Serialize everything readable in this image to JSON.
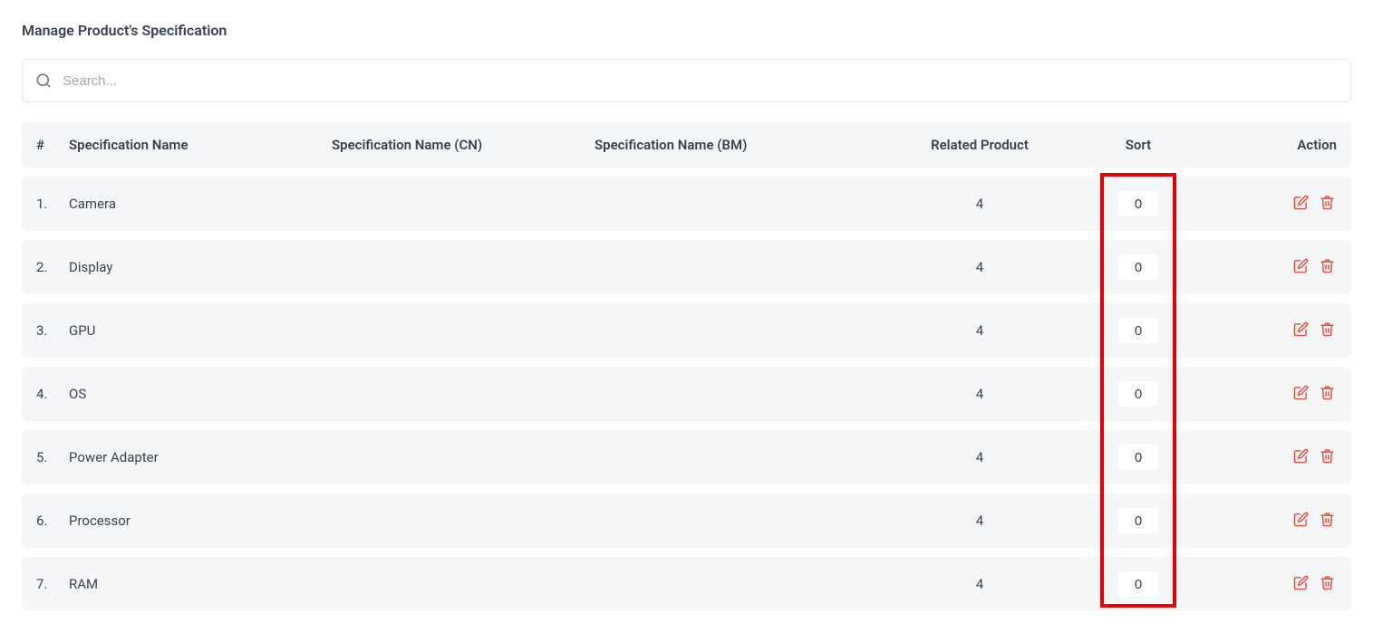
{
  "page": {
    "title": "Manage Product's Specification"
  },
  "search": {
    "placeholder": "Search..."
  },
  "headers": {
    "num": "#",
    "name": "Specification Name",
    "name_cn": "Specification Name (CN)",
    "name_bm": "Specification Name (BM)",
    "related": "Related Product",
    "sort": "Sort",
    "action": "Action"
  },
  "rows": [
    {
      "num": "1.",
      "name": "Camera",
      "name_cn": "",
      "name_bm": "",
      "related": "4",
      "sort": "0"
    },
    {
      "num": "2.",
      "name": "Display",
      "name_cn": "",
      "name_bm": "",
      "related": "4",
      "sort": "0"
    },
    {
      "num": "3.",
      "name": "GPU",
      "name_cn": "",
      "name_bm": "",
      "related": "4",
      "sort": "0"
    },
    {
      "num": "4.",
      "name": "OS",
      "name_cn": "",
      "name_bm": "",
      "related": "4",
      "sort": "0"
    },
    {
      "num": "5.",
      "name": "Power Adapter",
      "name_cn": "",
      "name_bm": "",
      "related": "4",
      "sort": "0"
    },
    {
      "num": "6.",
      "name": "Processor",
      "name_cn": "",
      "name_bm": "",
      "related": "4",
      "sort": "0"
    },
    {
      "num": "7.",
      "name": "RAM",
      "name_cn": "",
      "name_bm": "",
      "related": "4",
      "sort": "0"
    }
  ]
}
